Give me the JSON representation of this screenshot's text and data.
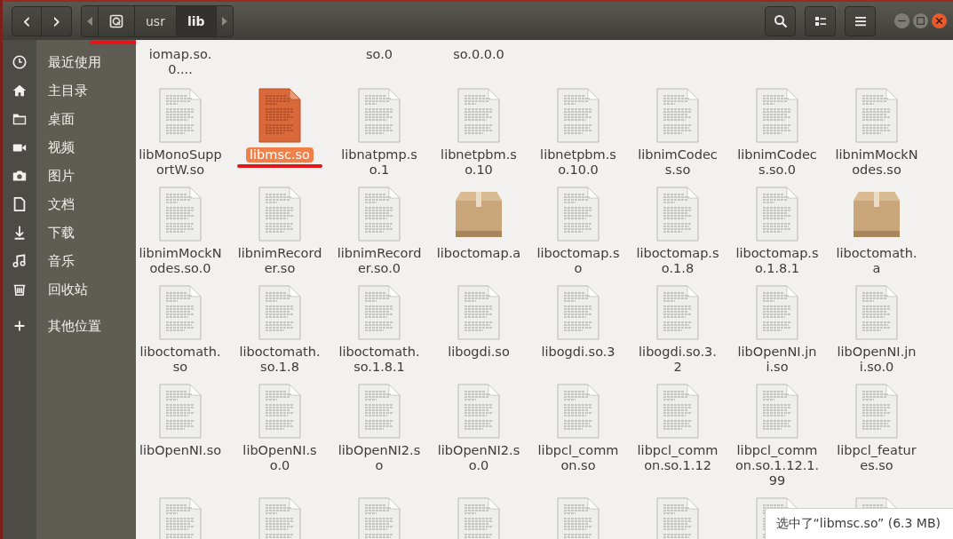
{
  "nav": {
    "back": "‹",
    "forward": "›"
  },
  "path": {
    "segments": [
      {
        "kind": "disk",
        "selected": false
      },
      {
        "kind": "text",
        "label": "usr",
        "selected": false
      },
      {
        "kind": "text",
        "label": "lib",
        "selected": true
      }
    ]
  },
  "sidebar": {
    "items": [
      {
        "kind": "clock",
        "label": "最近使用"
      },
      {
        "kind": "home",
        "label": "主目录"
      },
      {
        "kind": "folder",
        "label": "桌面"
      },
      {
        "kind": "video",
        "label": "视频"
      },
      {
        "kind": "camera",
        "label": "图片"
      },
      {
        "kind": "document",
        "label": "文档"
      },
      {
        "kind": "download",
        "label": "下载"
      },
      {
        "kind": "music",
        "label": "音乐"
      },
      {
        "kind": "trash",
        "label": "回收站"
      },
      {
        "kind": "plus",
        "label": "其他位置"
      }
    ]
  },
  "partial_row": [
    {
      "kind": "label",
      "tail": "iomap.so.0...."
    },
    {
      "kind": "hidden"
    },
    {
      "kind": "label",
      "tail": "so.0"
    },
    {
      "kind": "label",
      "tail": "so.0.0.0"
    },
    {
      "kind": "hidden"
    },
    {
      "kind": "hidden"
    },
    {
      "kind": "hidden"
    },
    {
      "kind": "hidden"
    }
  ],
  "files": [
    {
      "name": "libMonoSupportW.so",
      "kind": "document",
      "selected": false
    },
    {
      "name": "libmsc.so",
      "kind": "document",
      "selected": true
    },
    {
      "name": "libnatpmp.so.1",
      "kind": "document",
      "selected": false
    },
    {
      "name": "libnetpbm.so.10",
      "kind": "document",
      "selected": false
    },
    {
      "name": "libnetpbm.so.10.0",
      "kind": "document",
      "selected": false
    },
    {
      "name": "libnimCodecs.so",
      "kind": "document",
      "selected": false
    },
    {
      "name": "libnimCodecs.so.0",
      "kind": "document",
      "selected": false
    },
    {
      "name": "libnimMockNodes.so",
      "kind": "document",
      "selected": false
    },
    {
      "name": "libnimMockNodes.so.0",
      "kind": "document",
      "selected": false
    },
    {
      "name": "libnimRecorder.so",
      "kind": "document",
      "selected": false
    },
    {
      "name": "libnimRecorder.so.0",
      "kind": "document",
      "selected": false
    },
    {
      "name": "liboctomap.a",
      "kind": "package",
      "selected": false
    },
    {
      "name": "liboctomap.so",
      "kind": "document",
      "selected": false
    },
    {
      "name": "liboctomap.so.1.8",
      "kind": "document",
      "selected": false
    },
    {
      "name": "liboctomap.so.1.8.1",
      "kind": "document",
      "selected": false
    },
    {
      "name": "liboctomath.a",
      "kind": "package",
      "selected": false
    },
    {
      "name": "liboctomath.so",
      "kind": "document",
      "selected": false
    },
    {
      "name": "liboctomath.so.1.8",
      "kind": "document",
      "selected": false
    },
    {
      "name": "liboctomath.so.1.8.1",
      "kind": "document",
      "selected": false
    },
    {
      "name": "libogdi.so",
      "kind": "document",
      "selected": false
    },
    {
      "name": "libogdi.so.3",
      "kind": "document",
      "selected": false
    },
    {
      "name": "libogdi.so.3.2",
      "kind": "document",
      "selected": false
    },
    {
      "name": "libOpenNI.jni.so",
      "kind": "document",
      "selected": false
    },
    {
      "name": "libOpenNI.jni.so.0",
      "kind": "document",
      "selected": false
    },
    {
      "name": "libOpenNI.so",
      "kind": "document",
      "selected": false
    },
    {
      "name": "libOpenNI.so.0",
      "kind": "document",
      "selected": false
    },
    {
      "name": "libOpenNI2.so",
      "kind": "document",
      "selected": false
    },
    {
      "name": "libOpenNI2.so.0",
      "kind": "document",
      "selected": false
    },
    {
      "name": "libpcl_common.so",
      "kind": "document",
      "selected": false
    },
    {
      "name": "libpcl_common.so.1.12",
      "kind": "document",
      "selected": false
    },
    {
      "name": "libpcl_common.so.1.12.1.99",
      "kind": "document",
      "selected": false
    },
    {
      "name": "libpcl_features.so",
      "kind": "document",
      "selected": false
    }
  ],
  "cut_row": [
    {
      "kind": "document"
    },
    {
      "kind": "document"
    },
    {
      "kind": "document"
    },
    {
      "kind": "document"
    },
    {
      "kind": "document"
    },
    {
      "kind": "document"
    },
    {
      "kind": "document"
    },
    {
      "kind": "document"
    }
  ],
  "status": "选中了“libmsc.so” (6.3 MB)"
}
